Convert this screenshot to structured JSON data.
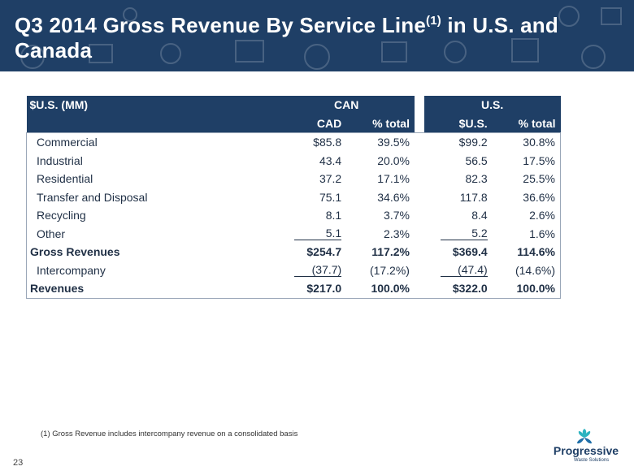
{
  "title": {
    "main": "Q3 2014 Gross Revenue By Service Line",
    "sup": "(1)",
    "suffix": " in U.S. and Canada"
  },
  "table": {
    "header_label": "$U.S. (MM)",
    "group_can": "CAN",
    "group_us": "U.S.",
    "sub_cad": "CAD",
    "sub_pct1": "% total",
    "sub_usd": "$U.S.",
    "sub_pct2": "% total",
    "rows": [
      {
        "name": "Commercial",
        "can": "$85.8",
        "can_pct": "39.5%",
        "us": "$99.2",
        "us_pct": "30.8%"
      },
      {
        "name": "Industrial",
        "can": "43.4",
        "can_pct": "20.0%",
        "us": "56.5",
        "us_pct": "17.5%"
      },
      {
        "name": "Residential",
        "can": "37.2",
        "can_pct": "17.1%",
        "us": "82.3",
        "us_pct": "25.5%"
      },
      {
        "name": "Transfer and Disposal",
        "can": "75.1",
        "can_pct": "34.6%",
        "us": "117.8",
        "us_pct": "36.6%"
      },
      {
        "name": "Recycling",
        "can": "8.1",
        "can_pct": "3.7%",
        "us": "8.4",
        "us_pct": "2.6%"
      },
      {
        "name": "Other",
        "can": "5.1",
        "can_pct": "2.3%",
        "us": "5.2",
        "us_pct": "1.6%"
      },
      {
        "name": "Gross Revenues",
        "can": "$254.7",
        "can_pct": "117.2%",
        "us": "$369.4",
        "us_pct": "114.6%"
      },
      {
        "name": "Intercompany",
        "can": "(37.7)",
        "can_pct": "(17.2%)",
        "us": "(47.4)",
        "us_pct": "(14.6%)"
      },
      {
        "name": "Revenues",
        "can": "$217.0",
        "can_pct": "100.0%",
        "us": "$322.0",
        "us_pct": "100.0%"
      }
    ]
  },
  "footnote": "(1) Gross Revenue includes intercompany revenue on a consolidated basis",
  "page_number": "23",
  "logo": {
    "word": "Progressive",
    "sub": "Waste Solutions"
  },
  "colors": {
    "banner": "#1f3f66",
    "text": "#1f2f45",
    "logo_teal": "#2bb3c0"
  }
}
